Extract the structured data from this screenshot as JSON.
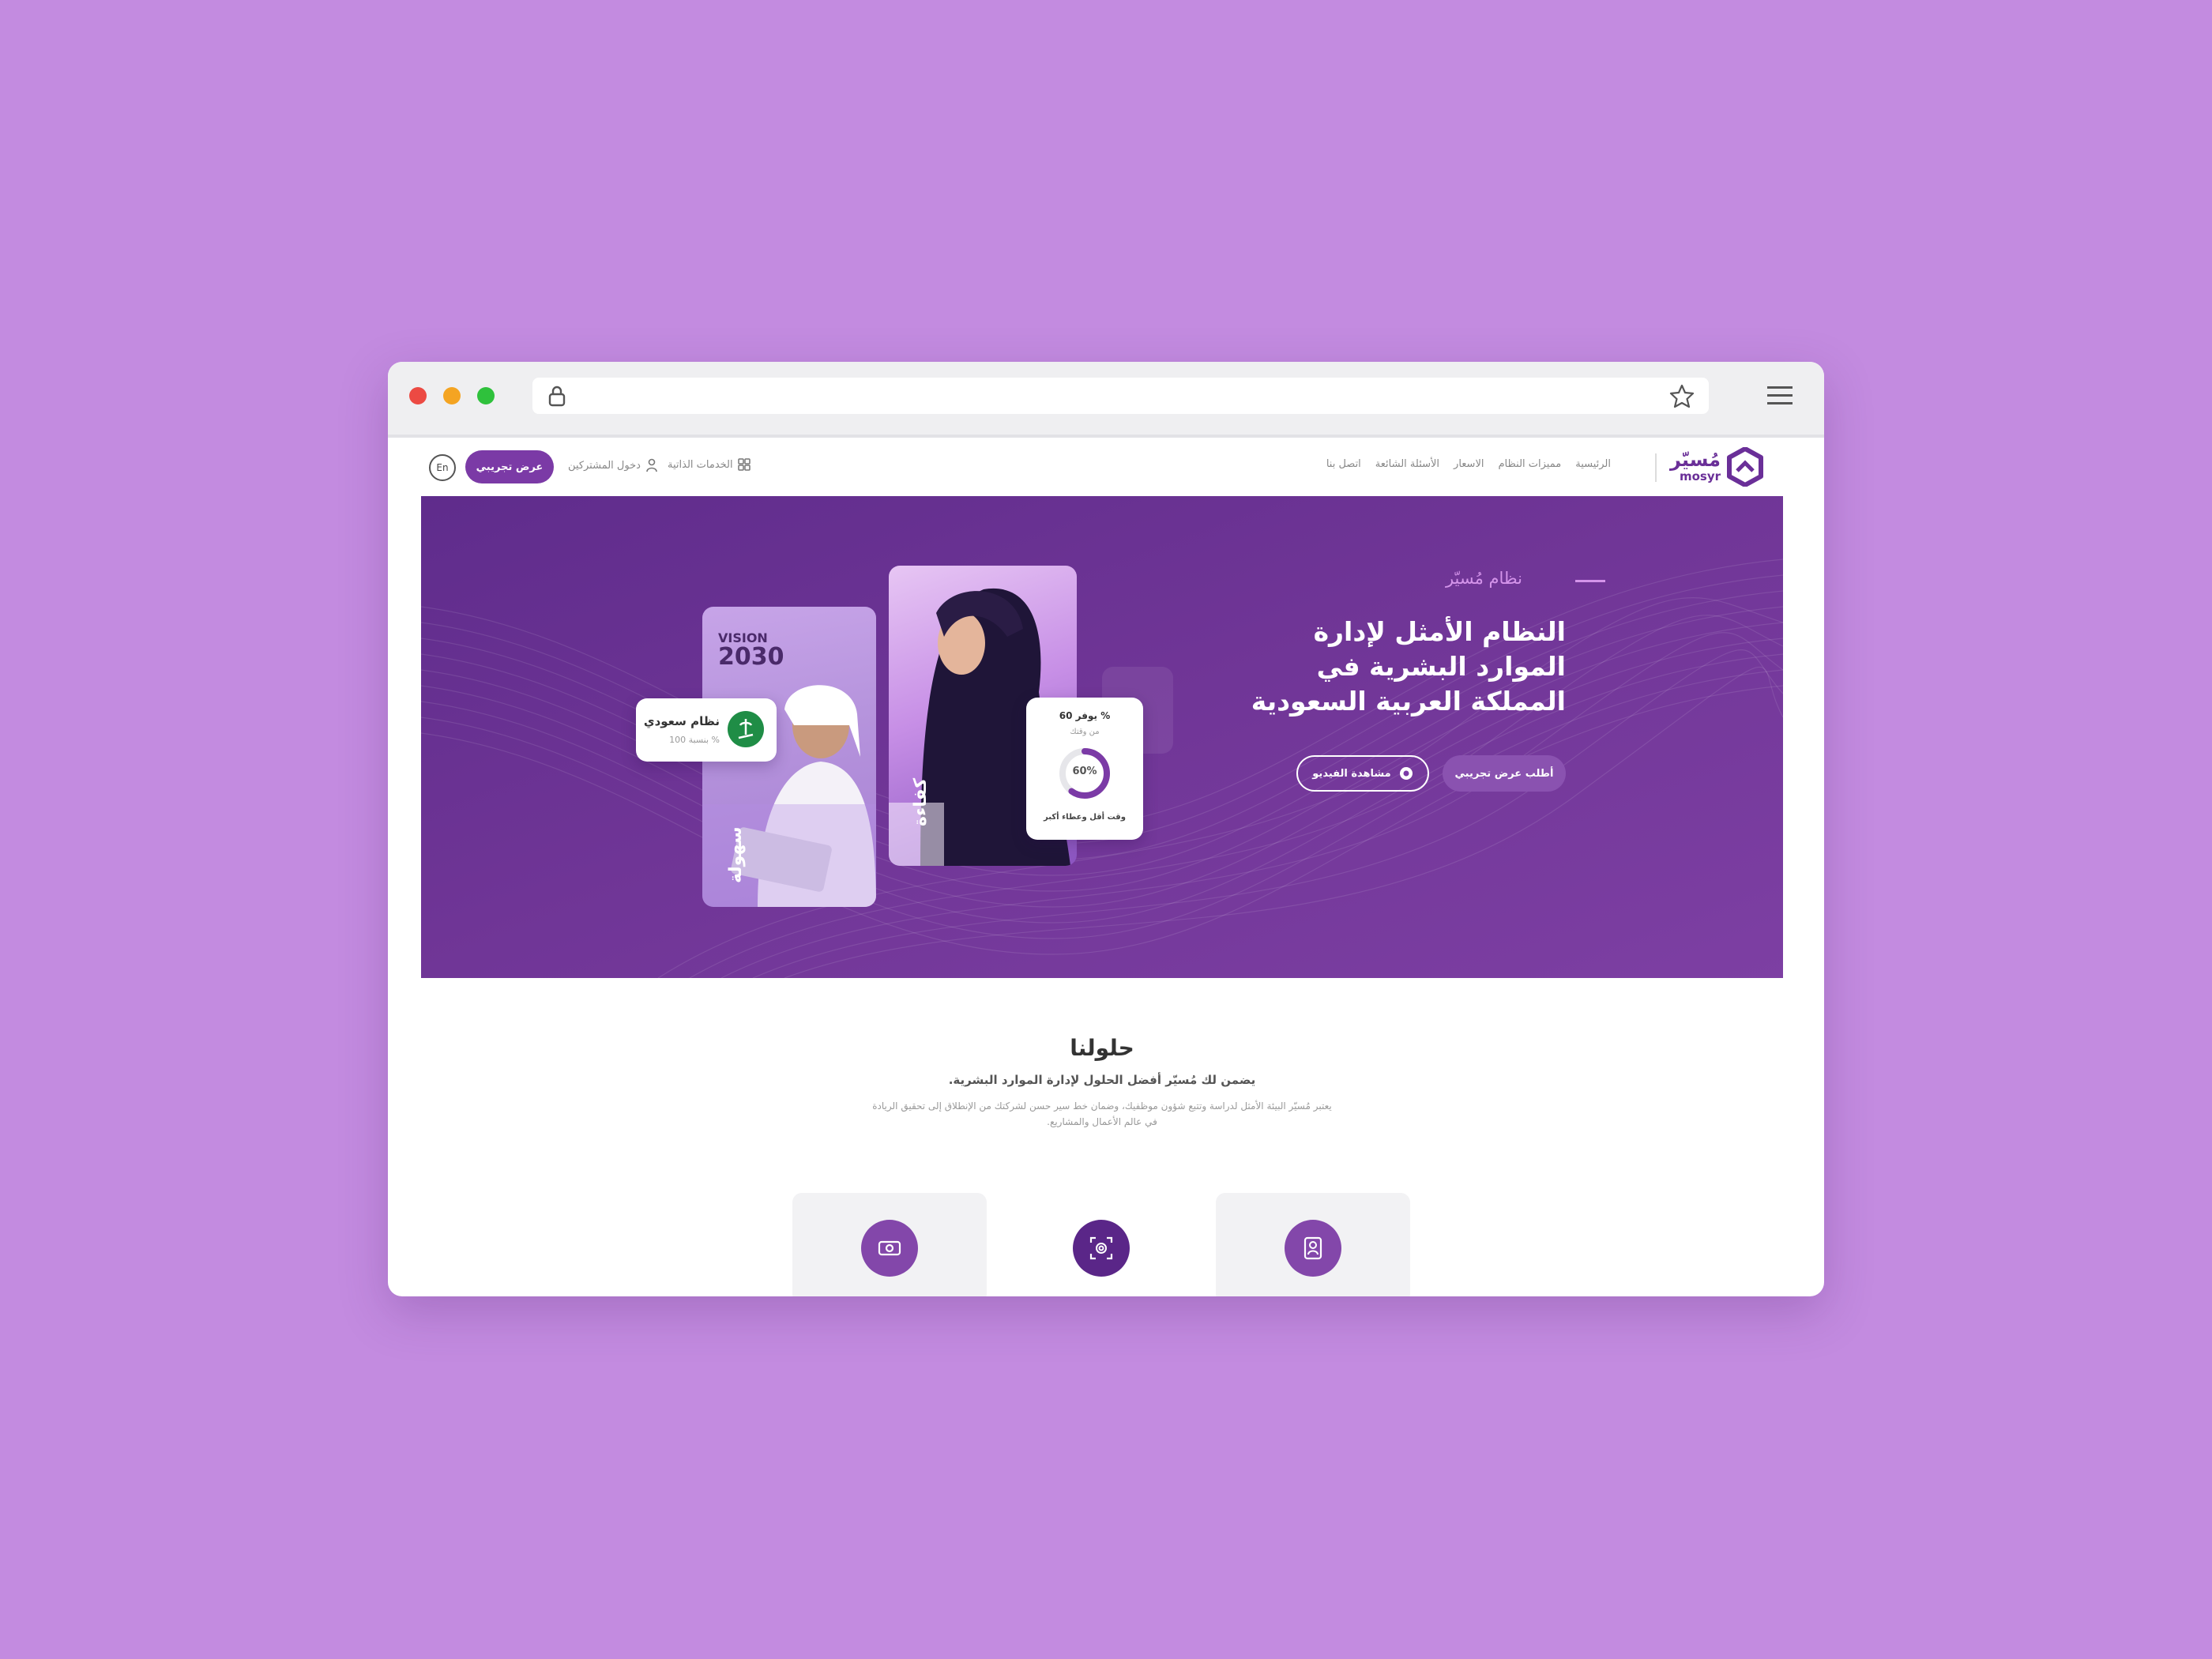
{
  "nav": {
    "logo_ar": "مُسيّر",
    "logo_en": "mosyr",
    "links": [
      "الرئيسية",
      "مميزات النظام",
      "الاسعار",
      "الأسئلة الشائعة",
      "اتصل بنا"
    ],
    "services": "الخدمات الذاتية",
    "subscribers": "دخول المشتركين",
    "demo_button": "عرض تجريبي",
    "lang_button": "En"
  },
  "hero": {
    "eyebrow": "نظام مُسيّر",
    "title": "النظام الأمثل لإدارة الموارد البشرية في المملكة العربية السعودية",
    "primary_button": "أطلب عرض تجريبي",
    "video_button": "مشاهدة الفيديو",
    "vision_word": "VISION",
    "vision_year": "2030",
    "card_man_caption": "سهولة",
    "card_woman_caption": "كفاءة",
    "saudi_card": {
      "title": "نظام سعودي",
      "subtitle": "بنسبة 100 %"
    },
    "stat_card": {
      "headline": "يوفر 60 %",
      "sub": "من وقتك",
      "percent_label": "60%",
      "percent": 60,
      "footer": "وقت أقل وعطاء أكبر"
    }
  },
  "solutions": {
    "title": "حلولنا",
    "subtitle": "يضمن لك مُسيّر أفضل الحلول لإدارة الموارد البشرية.",
    "description": "يعتبر مُسيّر البيئة الأمثل لدراسة وتتبع شؤون موظفيك، وضمان خط سير حسن لشركتك من الإنطلاق إلى تحقيق الريادة في عالم الأعمال والمشاريع.",
    "cards": [
      {
        "icon": "payroll-icon"
      },
      {
        "icon": "fingerprint-scan-icon"
      },
      {
        "icon": "employee-profile-icon"
      }
    ]
  },
  "colors": {
    "brand": "#7b3aa6",
    "hero_dark": "#5f2c8c",
    "accent_pink": "#d494ea",
    "saudi_green": "#1f8d46",
    "background": "#c38be0"
  }
}
